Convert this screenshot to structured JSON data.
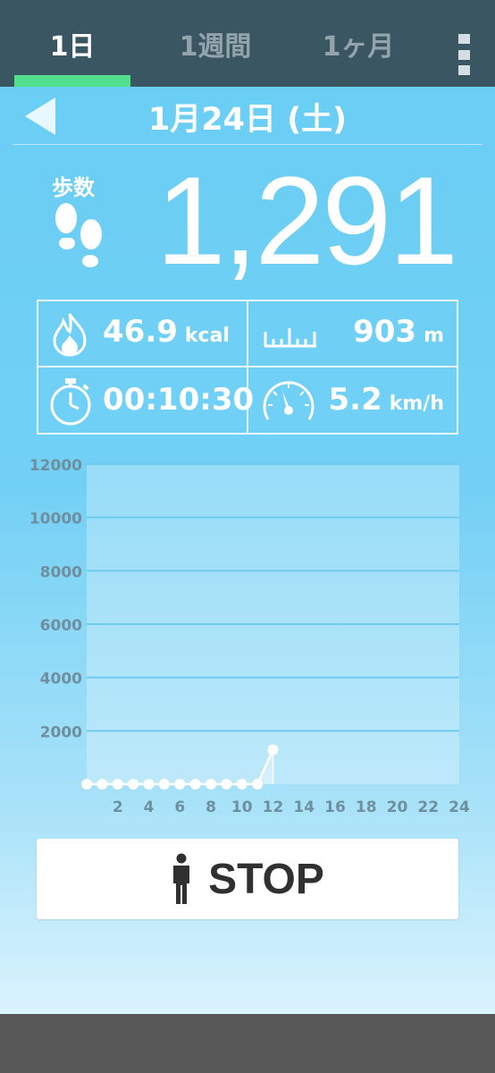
{
  "tabs": [
    {
      "label": "1日",
      "active": true
    },
    {
      "label": "1週間",
      "active": false
    },
    {
      "label": "1ヶ月",
      "active": false
    }
  ],
  "menu": {
    "icon": "more-vertical-icon"
  },
  "date": {
    "text": "1月24日 (土)",
    "back_icon": "back-arrow-icon"
  },
  "steps": {
    "label": "歩数",
    "value": "1,291",
    "icon": "footprints-icon"
  },
  "stats": {
    "calories": {
      "value": "46.9",
      "unit": "kcal",
      "icon": "flame-icon"
    },
    "distance": {
      "value": "903",
      "unit": "m",
      "icon": "ruler-icon"
    },
    "duration": {
      "value": "00:10:30",
      "icon": "stopwatch-icon"
    },
    "speed": {
      "value": "5.2",
      "unit": "km/h",
      "icon": "speedometer-icon"
    }
  },
  "chart_data": {
    "type": "line",
    "x_tick_labels": [
      "2",
      "4",
      "6",
      "8",
      "10",
      "12",
      "14",
      "16",
      "18",
      "20",
      "22",
      "24"
    ],
    "y_tick_labels": [
      "2000",
      "4000",
      "6000",
      "8000",
      "10000",
      "12000"
    ],
    "xlim": [
      0,
      24
    ],
    "ylim": [
      0,
      12000
    ],
    "grid": true,
    "x": [
      0,
      1,
      2,
      3,
      4,
      5,
      6,
      7,
      8,
      9,
      10,
      11,
      12
    ],
    "values": [
      0,
      0,
      0,
      0,
      0,
      0,
      0,
      0,
      0,
      0,
      0,
      0,
      1291
    ]
  },
  "stop_button": {
    "label": "STOP",
    "icon": "walking-person-icon"
  },
  "colors": {
    "topbar": "#3b5663",
    "tab_indicator": "#52e08e",
    "background_top": "#69cdf4",
    "background_bottom": "#e9f8fe",
    "navbar": "#585858"
  }
}
